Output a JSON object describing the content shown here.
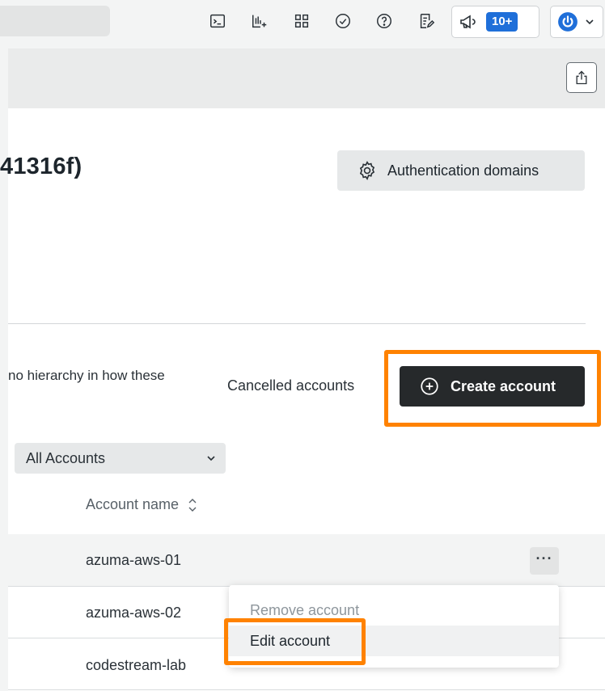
{
  "topbar": {
    "icons": [
      "terminal-icon",
      "add-chart-icon",
      "apps-grid-icon",
      "checkmark-circle-icon",
      "help-icon",
      "feedback-icon"
    ],
    "whats_new_badge": "10+",
    "user_menu_icon": "power-icon"
  },
  "header": {
    "org_title": "41316f)",
    "auth_domains_label": "Authentication domains"
  },
  "toolbar": {
    "description": "no hierarchy in how these",
    "cancelled_label": "Cancelled accounts",
    "create_label": "Create account"
  },
  "filter": {
    "selected": "All Accounts"
  },
  "table": {
    "column_header": "Account name",
    "rows": [
      "azuma-aws-01",
      "azuma-aws-02",
      "codestream-lab"
    ]
  },
  "row_menu": {
    "trigger": "···",
    "items": [
      "Remove account",
      "Edit account"
    ]
  },
  "colors": {
    "highlight": "#ff8200",
    "primary_button": "#26292b",
    "badge": "#1f6fd9"
  }
}
